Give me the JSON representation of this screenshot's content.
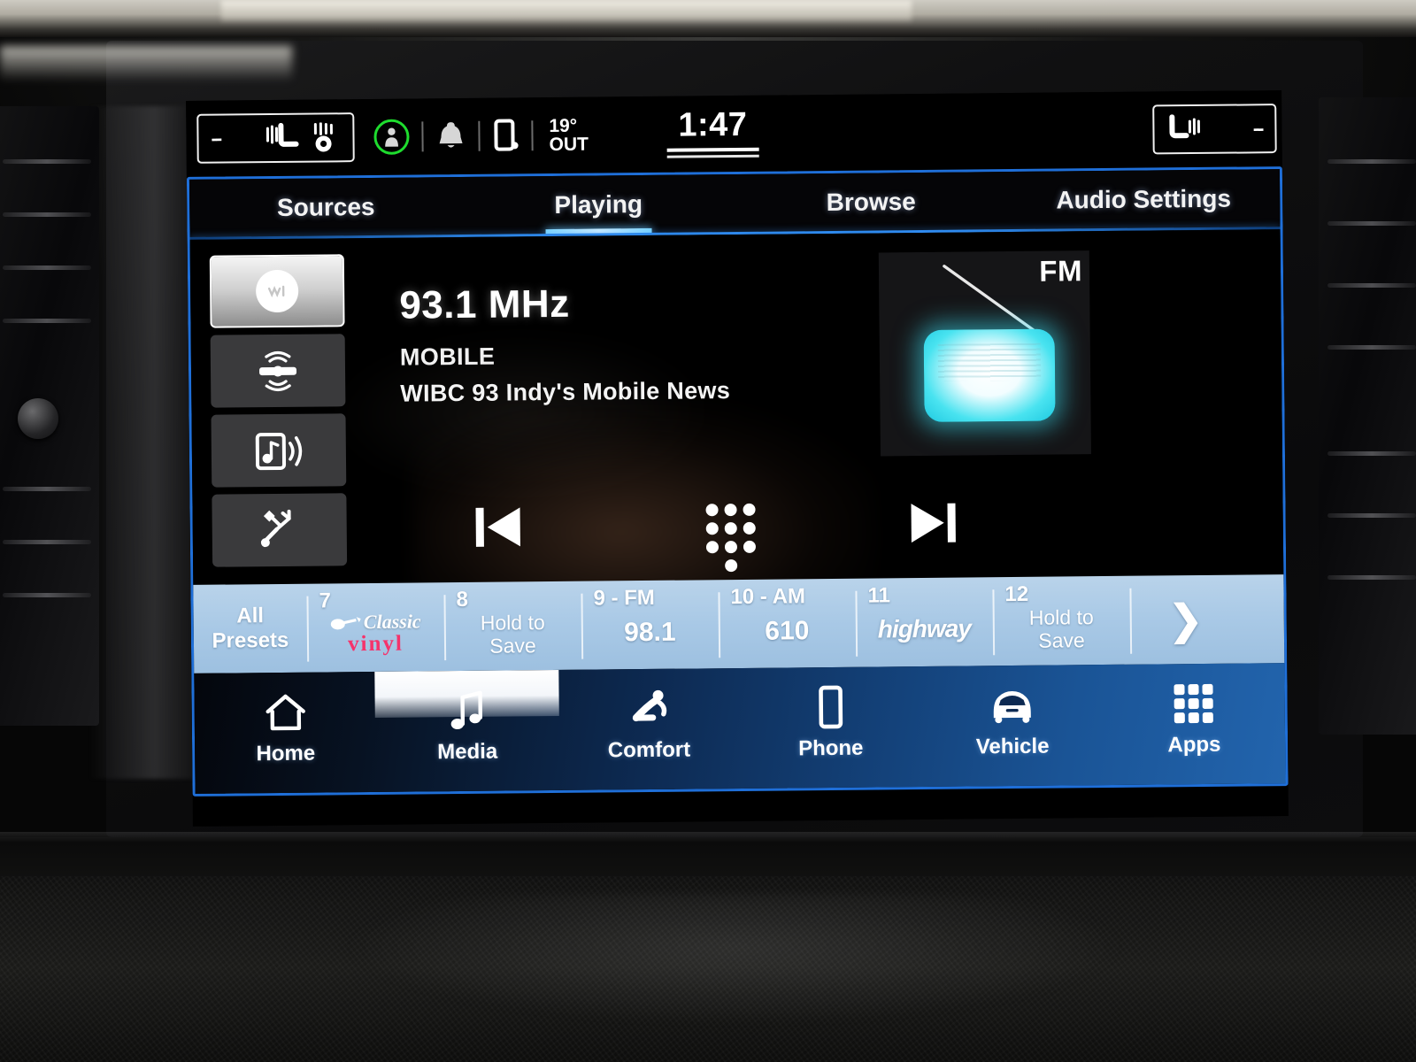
{
  "status_bar": {
    "left_widget": {
      "name": "driver-climate-widget",
      "value": "--",
      "icons": [
        "heated-seat-icon",
        "heated-steering-wheel-icon"
      ]
    },
    "right_widget": {
      "name": "passenger-climate-widget",
      "value": "--",
      "icons": [
        "heated-seat-icon"
      ]
    },
    "occupant_icon": "occupant-detected-icon",
    "occupant_ring_color": "#1edc2e",
    "notification_icon": "bell-icon",
    "phone_icon": "phone-connected-icon",
    "temperature": "19°",
    "temperature_label": "OUT",
    "clock": "1:47"
  },
  "tabs": [
    {
      "label": "Sources",
      "active": false
    },
    {
      "label": "Playing",
      "active": true
    },
    {
      "label": "Browse",
      "active": false
    },
    {
      "label": "Audio Settings",
      "active": false
    }
  ],
  "sources": [
    {
      "name": "source-fm-radio",
      "icon": "fm-radio-dial-icon",
      "active": true
    },
    {
      "name": "source-satellite-radio",
      "icon": "satellite-radio-icon",
      "active": false
    },
    {
      "name": "source-bluetooth-audio",
      "icon": "bluetooth-audio-icon",
      "active": false
    },
    {
      "name": "source-usb",
      "icon": "usb-icon",
      "active": false
    }
  ],
  "now_playing": {
    "frequency": "93.1 MHz",
    "program_type": "MOBILE",
    "radio_text": "WIBC 93 Indy's Mobile News",
    "band": "FM",
    "art_icon": "retro-radio-icon"
  },
  "transport": {
    "previous_label": "prev-track-icon",
    "keypad_label": "direct-tune-keypad-icon",
    "next_label": "next-track-icon"
  },
  "presets": {
    "all_presets_line1": "All",
    "all_presets_line2": "Presets",
    "next_page_icon": "chevron-right-icon",
    "items": [
      {
        "number": "7",
        "type": "logo",
        "logo": "classic-vinyl",
        "logo_top": "Classic",
        "logo_bottom": "vinyl",
        "value": ""
      },
      {
        "number": "8",
        "type": "empty",
        "hold_line1": "Hold to",
        "hold_line2": "Save",
        "value": ""
      },
      {
        "number": "9 - FM",
        "type": "station",
        "value": "98.1"
      },
      {
        "number": "10 - AM",
        "type": "station",
        "value": "610"
      },
      {
        "number": "11",
        "type": "logo",
        "logo": "highway",
        "logo_top": "highway",
        "value": ""
      },
      {
        "number": "12",
        "type": "empty",
        "hold_line1": "Hold to",
        "hold_line2": "Save",
        "value": ""
      }
    ]
  },
  "bottom_nav": [
    {
      "label": "Home",
      "icon": "home-icon",
      "active": false
    },
    {
      "label": "Media",
      "icon": "music-note-icon",
      "active": true
    },
    {
      "label": "Comfort",
      "icon": "seated-person-icon",
      "active": false
    },
    {
      "label": "Phone",
      "icon": "smartphone-icon",
      "active": false
    },
    {
      "label": "Vehicle",
      "icon": "car-front-icon",
      "active": false
    },
    {
      "label": "Apps",
      "icon": "grid-apps-icon",
      "active": false
    }
  ],
  "colors": {
    "screen_frame": "#1f6fd8",
    "tab_active_underline": "#7fd8ff",
    "preset_bar": "#a9c9e6",
    "nav_gradient_end": "#2264ad",
    "occupant_green": "#1edc2e",
    "radio_cyan": "#49e3f0",
    "vinyl_red": "#f5336b"
  }
}
